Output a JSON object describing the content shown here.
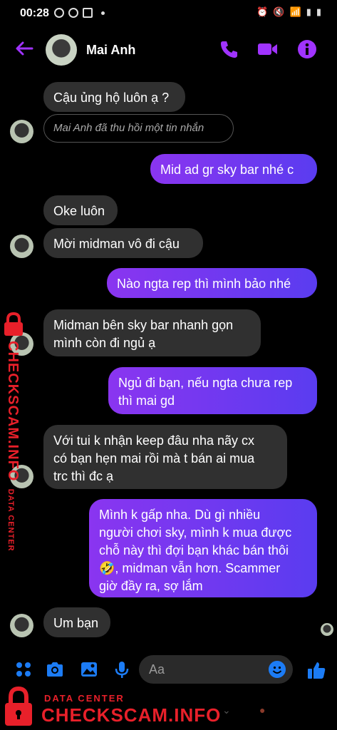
{
  "status_bar": {
    "time": "00:28"
  },
  "header": {
    "contact_name": "Mai Anh"
  },
  "messages": [
    {
      "text": "Cậu ủng hộ luôn ạ ?"
    },
    {
      "text": "Mai Anh đã thu hồi một tin nhắn"
    },
    {
      "text": "Mid ad gr sky bar nhé c"
    },
    {
      "text": "Oke luôn"
    },
    {
      "text": "Mời midman vô đi cậu"
    },
    {
      "text": "Nào ngta rep thì mình bảo nhé"
    },
    {
      "line1": "Midman bên sky bar nhanh gọn",
      "line2": "mình còn đi ngủ ạ"
    },
    {
      "line1": "Ngủ đi bạn, nếu ngta chưa rep",
      "line2": "thì mai gd"
    },
    {
      "line1": "Với tui k nhận keep đâu nha nãy cx",
      "line2": "có bạn hẹn mai rồi mà t bán ai mua",
      "line3": "trc thì đc ạ"
    },
    {
      "line1": "Mình k gấp nha. Dù gì nhiều",
      "line2": "người chơi sky, mình k mua được",
      "line3": "chỗ này thì đợi bạn khác bán thôi",
      "line4_emoji": "🤣",
      "line4": ", midman vẫn hơn. Scammer",
      "line5": "giờ đầy ra, sợ lắm"
    },
    {
      "text": "Um bạn"
    }
  ],
  "composer": {
    "placeholder": "Aa"
  },
  "watermark": {
    "small": "DATA CENTER",
    "big": "CHECKSCAM.INFO"
  },
  "colors": {
    "accent": "#a033ff",
    "outgoing_start": "#8a35f0",
    "outgoing_end": "#5a3cf0",
    "incoming": "#303030",
    "watermark": "#e8202a",
    "composer_icons": "#1c7cf5"
  },
  "icons": [
    "back-arrow-icon",
    "phone-icon",
    "video-camera-icon",
    "info-icon",
    "menu-dots-icon",
    "camera-icon",
    "image-icon",
    "microphone-icon",
    "emoji-icon",
    "thumbs-up-icon",
    "lock-icon"
  ]
}
